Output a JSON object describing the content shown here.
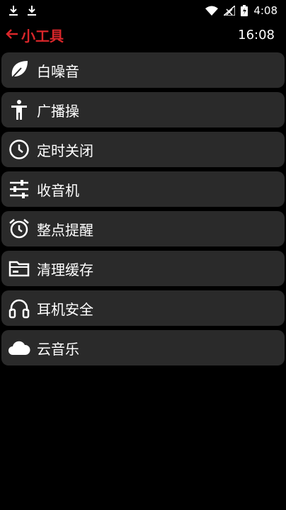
{
  "status_bar": {
    "time": "4:08",
    "icons": [
      "download-icon",
      "download-icon",
      "wifi-icon",
      "signal-icon",
      "battery-icon"
    ]
  },
  "header": {
    "title": "小工具",
    "clock": "16:08",
    "accent_color": "#d9262a"
  },
  "tools": [
    {
      "label": "白噪音",
      "icon": "leaf-icon"
    },
    {
      "label": "广播操",
      "icon": "person-icon"
    },
    {
      "label": "定时关闭",
      "icon": "clock-icon"
    },
    {
      "label": "收音机",
      "icon": "sliders-icon"
    },
    {
      "label": "整点提醒",
      "icon": "alarm-icon"
    },
    {
      "label": "清理缓存",
      "icon": "folder-icon"
    },
    {
      "label": "耳机安全",
      "icon": "headphones-icon"
    },
    {
      "label": "云音乐",
      "icon": "cloud-icon"
    }
  ]
}
